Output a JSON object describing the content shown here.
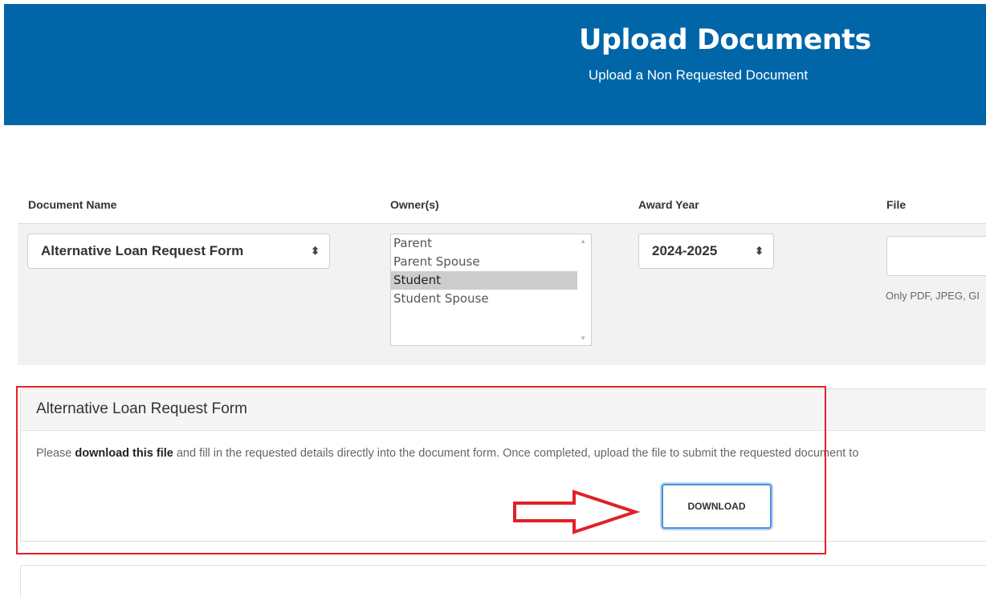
{
  "banner": {
    "title": "Upload Documents",
    "subtitle": "Upload a Non Requested Document",
    "background_color": "#0066a8"
  },
  "form": {
    "headers": {
      "document_name": "Document Name",
      "owners": "Owner(s)",
      "award_year": "Award Year",
      "file": "File"
    },
    "document_name_value": "Alternative Loan Request Form",
    "owners_options": [
      {
        "label": "Parent",
        "selected": false
      },
      {
        "label": "Parent Spouse",
        "selected": false
      },
      {
        "label": "Student",
        "selected": true
      },
      {
        "label": "Student Spouse",
        "selected": false
      }
    ],
    "award_year_value": "2024-2025",
    "file_hint": "Only PDF, JPEG, GI",
    "select_icon": "up-down-arrows-icon"
  },
  "panel": {
    "title": "Alternative Loan Request Form",
    "text_before": "Please ",
    "link_text": "download this file",
    "text_after": " and fill in the requested details directly into the document form. Once completed, upload the file to submit the requested document to",
    "button_label": "DOWNLOAD"
  },
  "annotation": {
    "frame_color": "#e32026",
    "arrow_icon": "right-arrow-icon"
  }
}
